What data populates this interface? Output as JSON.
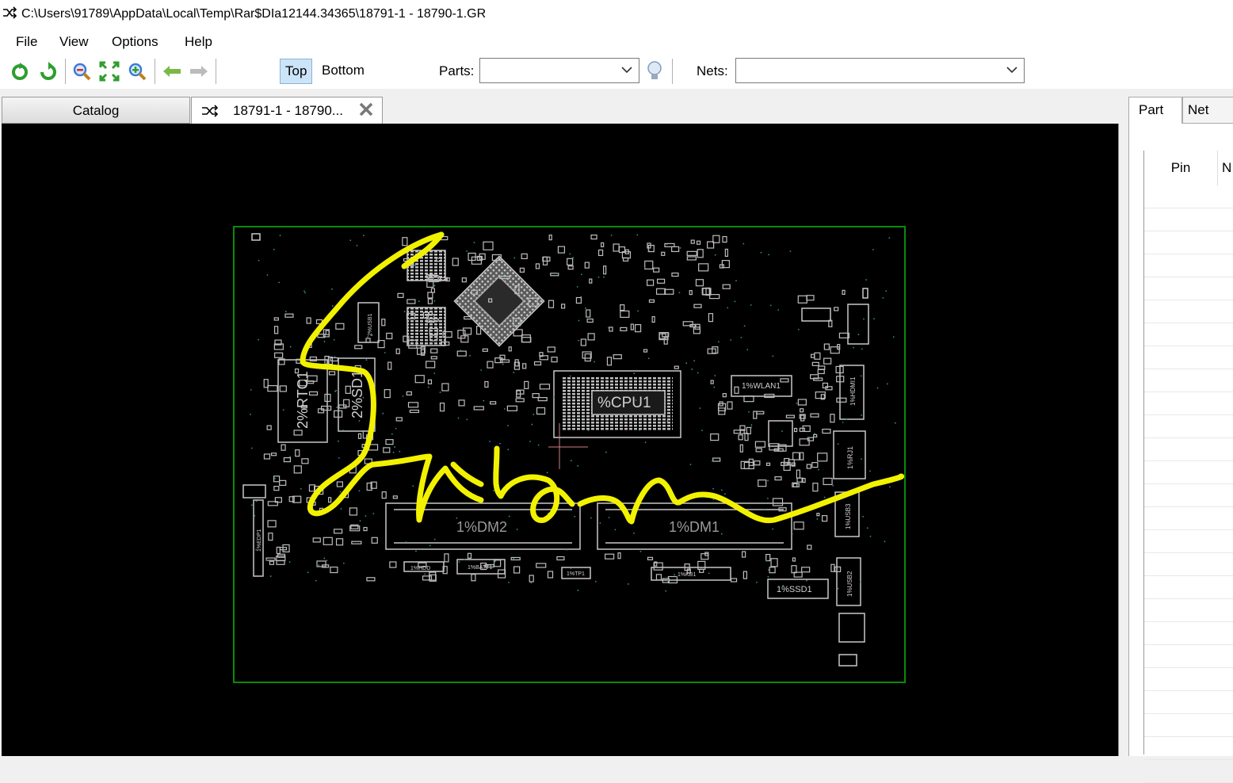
{
  "window": {
    "title": "C:\\Users\\91789\\AppData\\Local\\Temp\\Rar$DIa12144.34365\\18791-1 - 18790-1.GR",
    "icon": "shuffle-icon"
  },
  "menu": {
    "items": [
      "File",
      "View",
      "Options",
      "Help"
    ]
  },
  "toolbar": {
    "buttons": [
      "reload-icon",
      "refresh-icon",
      "zoom-out-icon",
      "fit-view-icon",
      "zoom-in-icon",
      "back-arrow-icon",
      "forward-arrow-icon"
    ],
    "top_label": "Top",
    "bottom_label": "Bottom",
    "parts_label": "Parts:",
    "parts_value": "",
    "nets_label": "Nets:",
    "nets_value": "",
    "highlight_icon": "lightbulb-icon"
  },
  "tabs": {
    "catalog": "Catalog",
    "document": "18791-1 - 18790...",
    "document_icon": "shuffle-icon"
  },
  "board": {
    "components": [
      "%CPU1",
      "1%WLAN1",
      "2%RTC1",
      "2%SD1",
      "1%DM2",
      "1%DM1",
      "1%SSD1",
      "1%HDMI1",
      "1%RJ1",
      "1%USB3",
      "1%USB2",
      "2%USB1",
      "1%HDD",
      "1%BATT1",
      "1%TP1",
      "1%KB1",
      "1%EDP1"
    ],
    "annotation": "handwritten yellow signature"
  },
  "side_panel": {
    "tabs": [
      "Part",
      "Net"
    ],
    "columns": [
      "Pin",
      "N"
    ]
  },
  "colors": {
    "board_outline": "#0a8a0a",
    "signature": "#f2f200",
    "silkscreen": "#c8c8c8",
    "active_toggle": "#cce4f7"
  }
}
